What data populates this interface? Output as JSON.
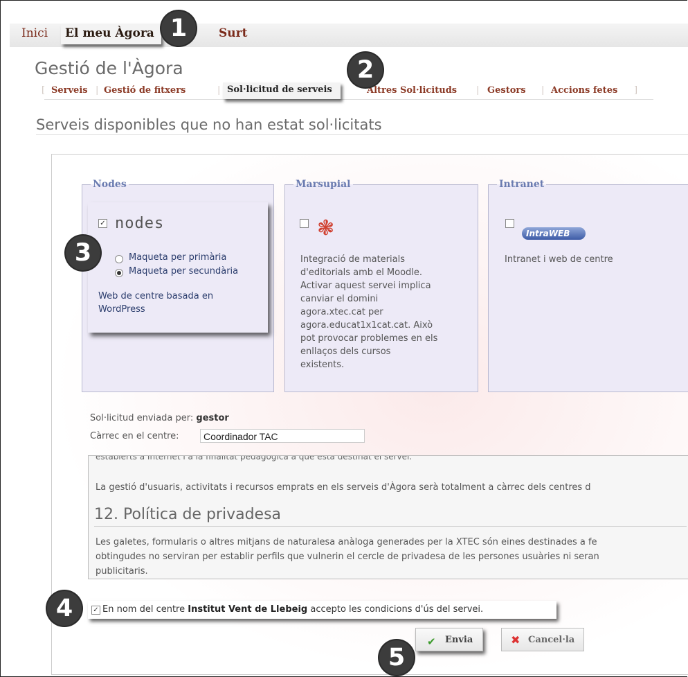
{
  "topnav": {
    "inici": "Inici",
    "meu_agora": "El meu Àgora",
    "surt": "Surt"
  },
  "page_title": "Gestió de l'Àgora",
  "subtabs": {
    "open": "[",
    "close": "]",
    "items": [
      "Serveis",
      "Gestió de fitxers",
      "Sol·licitud de serveis",
      "Altres Sol·licituds",
      "Gestors",
      "Accions fetes"
    ],
    "active": "Sol·licitud de serveis"
  },
  "section_title": "Serveis disponibles que no han estat sol·licitats",
  "services": {
    "nodes": {
      "legend": "Nodes",
      "logo_text": "nodes",
      "checked": true,
      "options": [
        "Maqueta per primària",
        "Maqueta per secundària"
      ],
      "selected_option": "Maqueta per secundària",
      "description_line1": "Web de centre basada en",
      "description_line2": "WordPress"
    },
    "marsupial": {
      "legend": "Marsupial",
      "checked": false,
      "description_lines": [
        "Integració de materials",
        "d'editorials amb el Moodle.",
        "Activar aquest servei implica",
        "canviar el domini",
        "agora.xtec.cat per",
        "agora.educat1x1cat.cat. Això",
        "pot provocar problemes en els",
        "enllaços dels cursos",
        "existents."
      ]
    },
    "intranet": {
      "legend": "Intranet",
      "checked": false,
      "logo_text": "IntraWEB",
      "description": "Intranet i web de centre"
    }
  },
  "request": {
    "sent_by_label": "Sol·licitud enviada per:",
    "sent_by_value": "gestor",
    "role_label": "Càrrec en el centre:",
    "role_value": "Coordinador TAC"
  },
  "terms": {
    "cut_line": "establerts a Internet i a la finalitat pedagògica a què està destinat el servei.",
    "paragraph1": "La gestió d'usuaris, activitats i recursos emprats en els serveis d'Àgora serà totalment a càrrec dels centres d",
    "heading": "12. Política de privadesa",
    "paragraph2_lines": [
      "Les galetes, formularis o altres mitjans de naturalesa anàloga generades per la XTEC són eines destinades a fe",
      "obtingudes no serviran per establir perfils que vulnerin el cercle de privadesa de les persones usuàries ni seran",
      "publicitaris."
    ]
  },
  "accept": {
    "checked": true,
    "prefix": "En nom del centre",
    "school": "Institut Vent de Llebeig",
    "suffix": "accepto les condicions d'ús del servei."
  },
  "buttons": {
    "submit": "Envia",
    "cancel": "Cancel·la"
  },
  "badges": [
    "1",
    "2",
    "3",
    "4",
    "5"
  ]
}
